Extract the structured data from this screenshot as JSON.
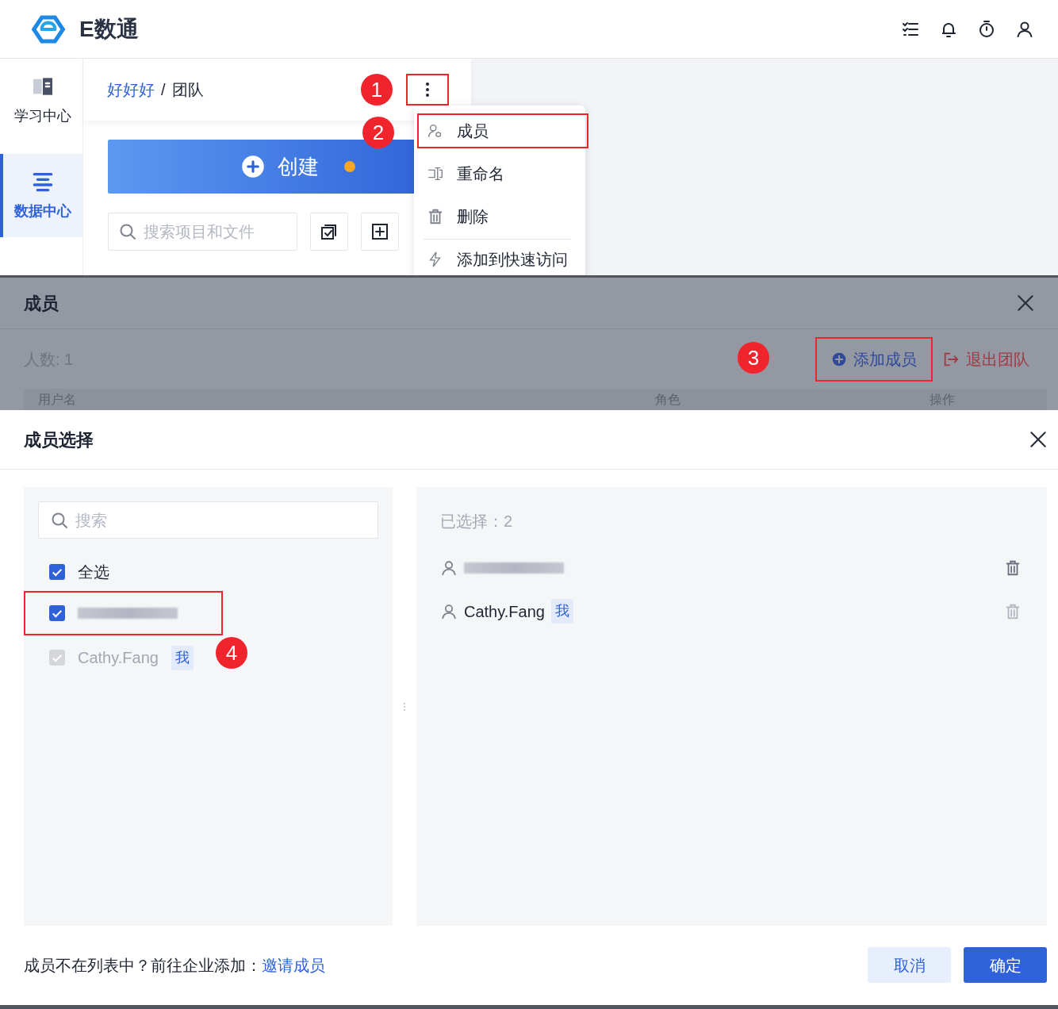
{
  "header": {
    "logo_text": "E数通"
  },
  "sidebar": {
    "items": [
      {
        "label": "学习中心",
        "selected": false
      },
      {
        "label": "数据中心",
        "selected": true
      }
    ]
  },
  "panel": {
    "breadcrumb": [
      {
        "label": "好好好",
        "kind": "link"
      },
      {
        "label": "团队",
        "kind": "current"
      }
    ],
    "separator": "/",
    "more_button": {
      "highlighted": true,
      "annotation": "1"
    },
    "create_button": {
      "label": "创建",
      "notification_dot": true
    },
    "search": {
      "placeholder": "搜索项目和文件"
    }
  },
  "menu": {
    "items": [
      {
        "label": "成员",
        "kind": "members",
        "highlighted": true,
        "annotation": "2",
        "divider_before": false
      },
      {
        "label": "重命名",
        "kind": "rename",
        "highlighted": false,
        "divider_before": false
      },
      {
        "label": "删除",
        "kind": "delete",
        "highlighted": false,
        "divider_before": false
      },
      {
        "label": "添加到快速访问",
        "kind": "quick",
        "highlighted": false,
        "divider_before": true
      }
    ]
  },
  "members_dialog": {
    "title": "成员",
    "count": "人数: 1",
    "add_button": {
      "label": "添加成员",
      "highlighted": true,
      "annotation": "3"
    },
    "leave_button": {
      "label": "退出团队"
    },
    "columns": [
      "用户名",
      "角色",
      "操作"
    ]
  },
  "select_dialog": {
    "title": "成员选择",
    "search": {
      "placeholder": "搜索"
    },
    "select_all": {
      "label": "全选",
      "checked": true
    },
    "candidates": [
      {
        "kind": "redacted",
        "checked": true,
        "disabled": false,
        "highlighted": true
      },
      {
        "kind": "named",
        "name": "Cathy.Fang",
        "tag": "我",
        "checked": true,
        "disabled": true,
        "highlighted": false
      }
    ],
    "step_badge": "4",
    "chosen_label": "已选择：2",
    "chosen": [
      {
        "kind": "redacted",
        "remove_disabled": false
      },
      {
        "kind": "named",
        "name": "Cathy.Fang",
        "tag": "我",
        "remove_disabled": true
      }
    ],
    "footer_text": "成员不在列表中？前往企业添加：",
    "footer_link": "邀请成员",
    "cancel": "取消",
    "confirm": "确定"
  }
}
